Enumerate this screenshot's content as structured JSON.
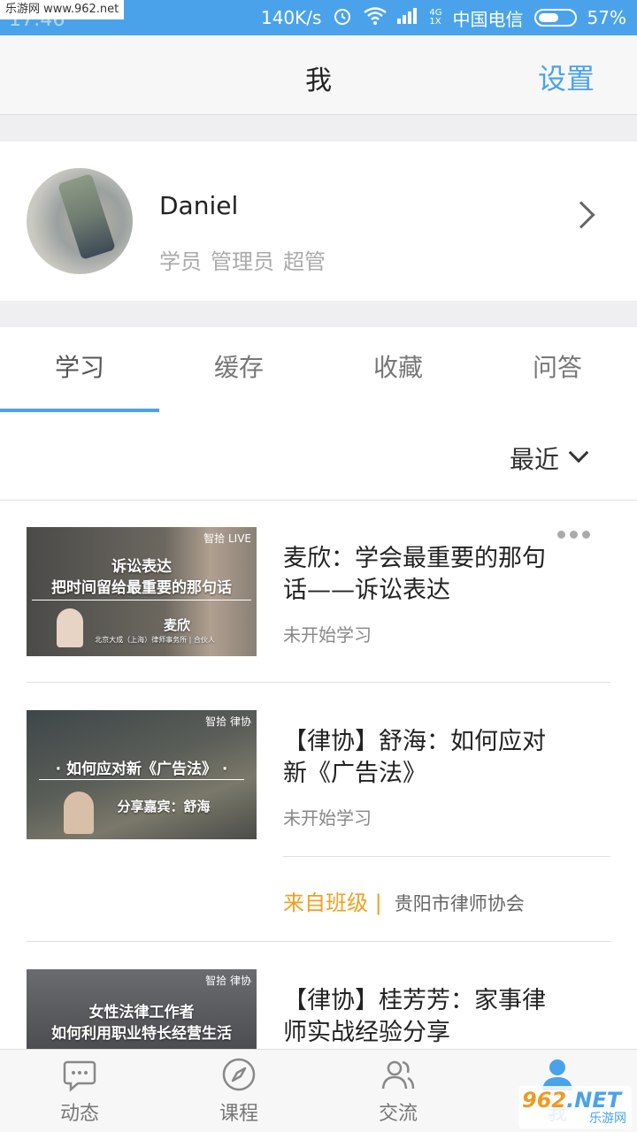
{
  "status_bar": {
    "site": "乐游网 www.962.net",
    "time": "17:46",
    "speed": "140K/s",
    "network_top": "4G",
    "network_bottom": "1X",
    "carrier": "中国电信",
    "battery": "57%",
    "battery_level": 0.57
  },
  "header": {
    "title": "我",
    "settings_label": "设置"
  },
  "profile": {
    "name": "Daniel",
    "roles": [
      "学员",
      "管理员",
      "超管"
    ]
  },
  "tabs": [
    {
      "label": "学习",
      "active": true
    },
    {
      "label": "缓存",
      "active": false
    },
    {
      "label": "收藏",
      "active": false
    },
    {
      "label": "问答",
      "active": false
    }
  ],
  "sort": {
    "label": "最近"
  },
  "courses": [
    {
      "title": "麦欣：学会最重要的那句话——诉讼表达",
      "status": "未开始学习",
      "thumb": {
        "brand": "智拾 LIVE",
        "line1": "诉讼表达",
        "line2": "把时间留给最重要的那句话",
        "speaker": "麦欣",
        "affiliation": "北京大成（上海）律师事务所 | 合伙人"
      }
    },
    {
      "title": "【律协】舒海：如何应对新《广告法》",
      "status": "未开始学习",
      "from_label": "来自班级 |",
      "from_value": "贵阳市律师协会",
      "thumb": {
        "brand": "智拾 律协",
        "line1": "· 如何应对新《广告法》 ·",
        "line2": "分享嘉宾：舒海"
      }
    },
    {
      "title": "【律协】桂芳芳：家事律师实战经验分享",
      "thumb": {
        "brand": "智拾 律协",
        "line1": "女性法律工作者",
        "line2": "如何利用职业特长经营生活"
      }
    }
  ],
  "bottom_nav": [
    {
      "label": "动态",
      "icon": "chat-bubble-icon"
    },
    {
      "label": "课程",
      "icon": "compass-icon"
    },
    {
      "label": "交流",
      "icon": "people-icon"
    },
    {
      "label": "我",
      "icon": "person-icon",
      "active": true
    }
  ],
  "watermark": {
    "main": "962",
    "net": ".NET",
    "sub": "乐游网"
  },
  "colors": {
    "accent": "#4aa3ea",
    "class_label": "#f0a020"
  }
}
